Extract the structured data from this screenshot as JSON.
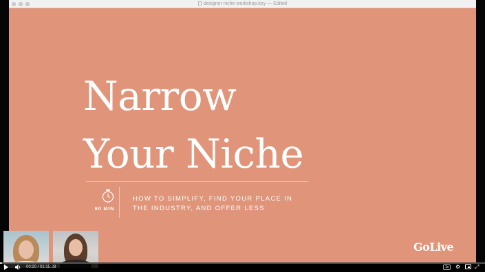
{
  "window": {
    "title": "designer niche workshop.key",
    "separator": "—",
    "status": "Edited"
  },
  "slide": {
    "title_line1": "Narrow",
    "title_line2": "Your Niche",
    "duration": "60 MIN",
    "subtitle_line1": "HOW TO SIMPLIFY, FIND YOUR PLACE IN",
    "subtitle_line2": "THE INDUSTRY, AND OFFER LESS",
    "logo": "GoLive",
    "colors": {
      "background": "#e0957a",
      "text": "#ffffff"
    },
    "timer_icon": "stopwatch-icon"
  },
  "player": {
    "time_display": "00:20 / 01:15:28",
    "progress_fraction": 0.004,
    "speed": "1x",
    "icons": {
      "play": "play-icon",
      "volume": "volume-icon",
      "settings": "gear-icon",
      "pip": "picture-in-picture-icon",
      "fullscreen": "fullscreen-icon"
    }
  }
}
